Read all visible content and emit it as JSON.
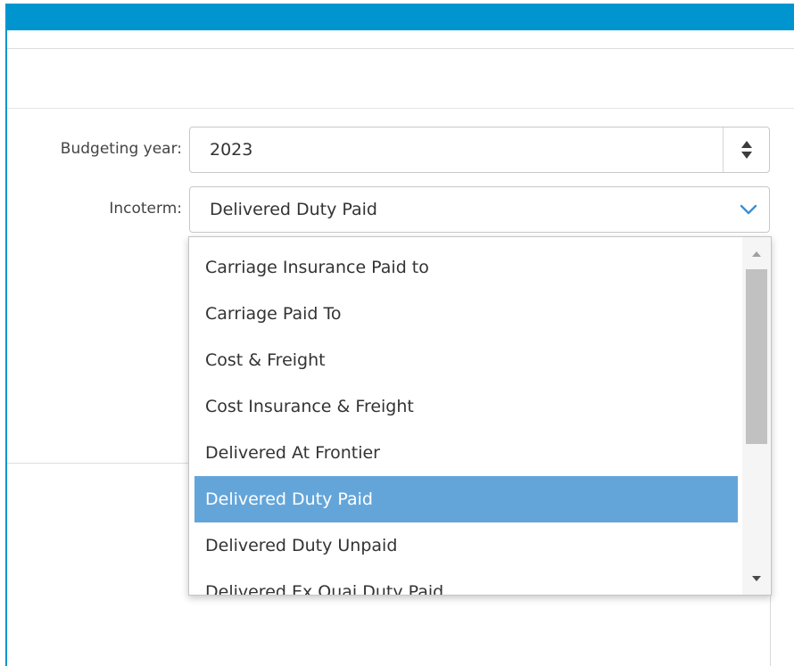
{
  "form": {
    "budgeting_year": {
      "label": "Budgeting year:",
      "value": "2023"
    },
    "incoterm": {
      "label": "Incoterm:",
      "value": "Delivered Duty Paid",
      "options": [
        "Carriage Insurance Paid to",
        "Carriage Paid To",
        "Cost & Freight",
        "Cost Insurance & Freight",
        "Delivered At Frontier",
        "Delivered Duty Paid",
        "Delivered Duty Unpaid",
        "Delivered Ex Quai Duty Paid"
      ],
      "selected_option": "Delivered Duty Paid"
    }
  },
  "icons": {
    "spinner": "up-down-spinner-icon",
    "dropdown": "chevron-down-icon",
    "scroll_up": "scroll-up-arrow-icon",
    "scroll_down": "scroll-down-arrow-icon"
  },
  "colors": {
    "header": "#0095cf",
    "selection": "#64a5d9",
    "chevron": "#3a8fd6"
  }
}
